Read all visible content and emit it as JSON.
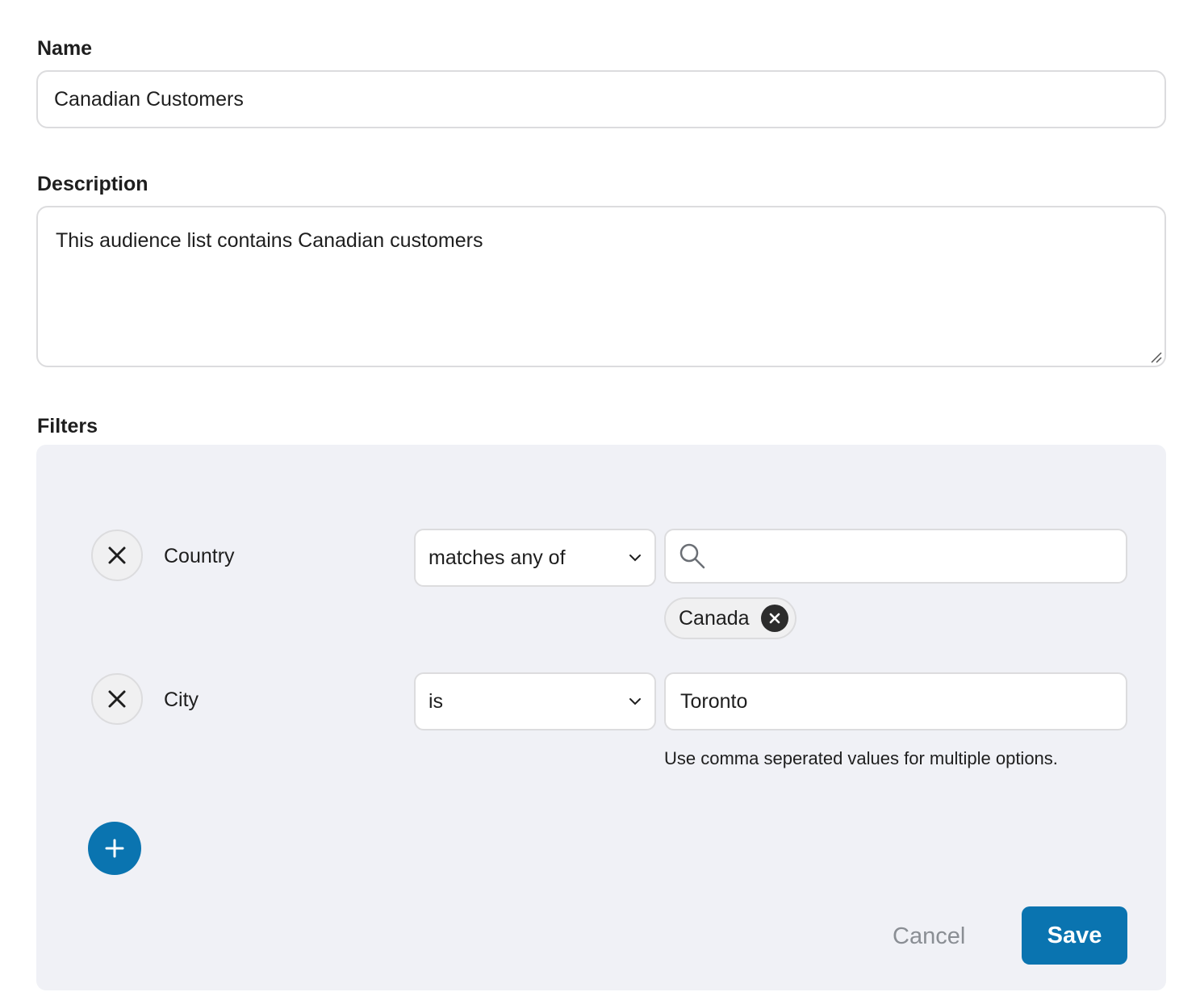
{
  "form": {
    "name_label": "Name",
    "name_value": "Canadian Customers",
    "description_label": "Description",
    "description_value": "This audience list contains Canadian customers",
    "filters_label": "Filters"
  },
  "filters": [
    {
      "field": "Country",
      "operator": "matches any of",
      "search_value": "",
      "chips": [
        "Canada"
      ]
    },
    {
      "field": "City",
      "operator": "is",
      "value": "Toronto",
      "help": "Use comma seperated values for multiple options."
    }
  ],
  "actions": {
    "cancel_label": "Cancel",
    "save_label": "Save"
  },
  "icons": {
    "remove": "close-icon",
    "dropdown": "chevron-down-icon",
    "search": "search-icon",
    "chip_remove": "close-circle-icon",
    "add": "plus-icon"
  },
  "colors": {
    "accent": "#0a74b0",
    "panel_background": "#f0f1f6",
    "border": "#dcdcde"
  }
}
